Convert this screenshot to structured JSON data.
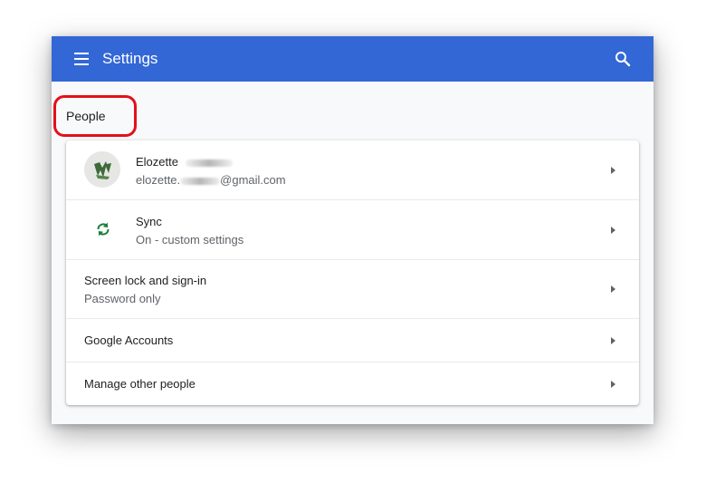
{
  "toolbar": {
    "title": "Settings",
    "menu_icon": "menu-icon",
    "search_icon": "search-icon",
    "color": "#3367d6"
  },
  "section": {
    "title": "People",
    "highlight_color": "#e3101c"
  },
  "rows": [
    {
      "primary": "Elozette",
      "secondary_prefix": "elozette.",
      "secondary_suffix": "@gmail.com",
      "icon": "avatar"
    },
    {
      "primary": "Sync",
      "secondary": "On - custom settings",
      "icon": "sync-icon",
      "icon_color": "#188038"
    },
    {
      "primary": "Screen lock and sign-in",
      "secondary": "Password only"
    },
    {
      "primary": "Google Accounts"
    },
    {
      "primary": "Manage other people"
    }
  ]
}
